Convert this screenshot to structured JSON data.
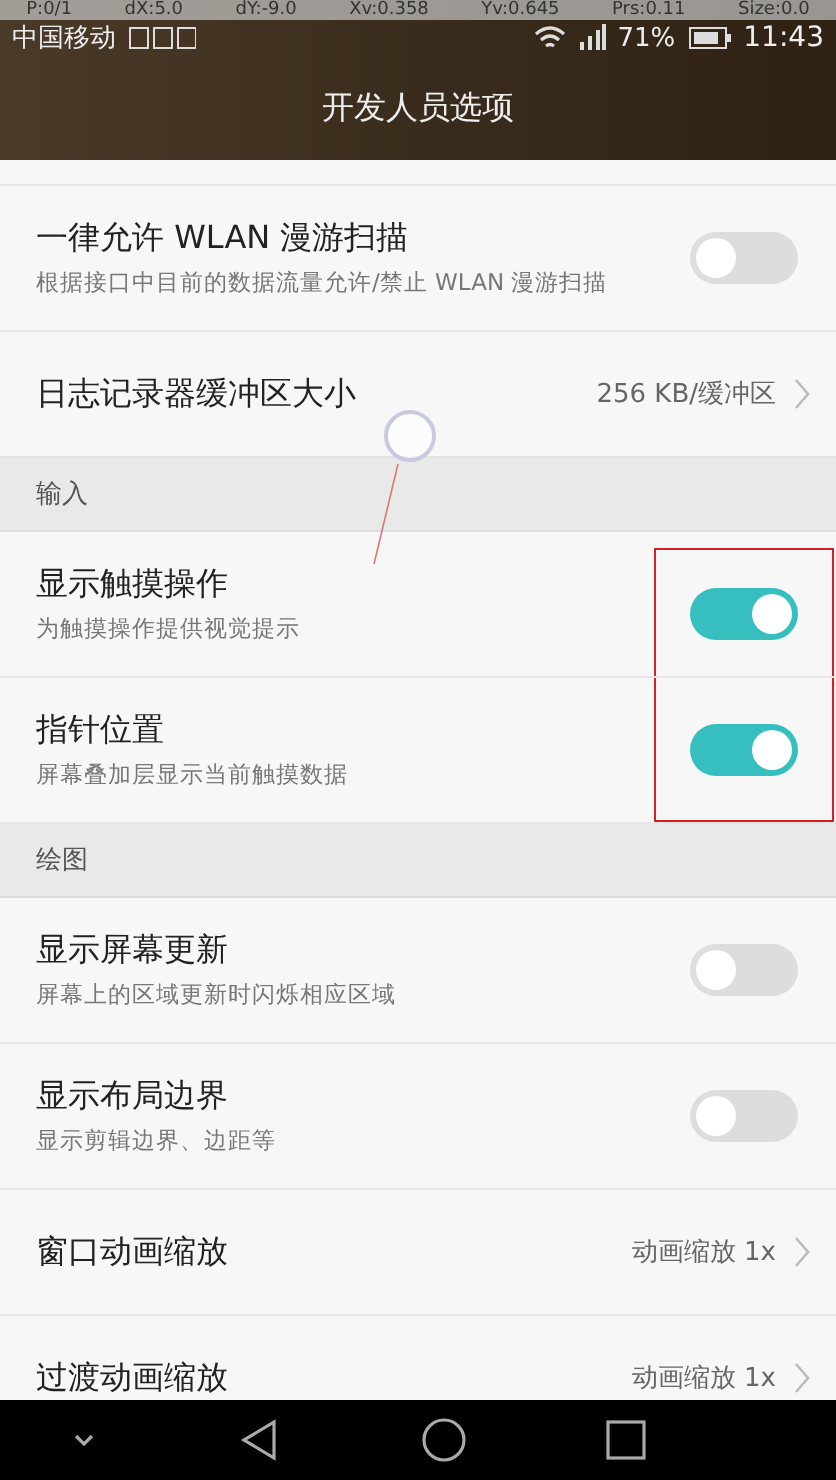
{
  "pointer_overlay": [
    "P:0/1",
    "dX:5.0",
    "dY:-9.0",
    "Xv:0.358",
    "Yv:0.645",
    "Prs:0.11",
    "Size:0.0"
  ],
  "status_bar": {
    "carrier": "中国移动",
    "battery": "71%",
    "time": "11:43"
  },
  "title": "开发人员选项",
  "items": [
    {
      "kind": "toggle",
      "title": "一律允许 WLAN 漫游扫描",
      "subtitle": "根据接口中目前的数据流量允许/禁止 WLAN 漫游扫描",
      "on": false,
      "highlighted": false
    },
    {
      "kind": "value",
      "title": "日志记录器缓冲区大小",
      "value": "256 KB/缓冲区"
    },
    {
      "kind": "header",
      "title": "输入"
    },
    {
      "kind": "toggle",
      "title": "显示触摸操作",
      "subtitle": "为触摸操作提供视觉提示",
      "on": true,
      "highlighted": true
    },
    {
      "kind": "toggle",
      "title": "指针位置",
      "subtitle": "屏幕叠加层显示当前触摸数据",
      "on": true,
      "highlighted": true
    },
    {
      "kind": "header",
      "title": "绘图"
    },
    {
      "kind": "toggle",
      "title": "显示屏幕更新",
      "subtitle": "屏幕上的区域更新时闪烁相应区域",
      "on": false,
      "highlighted": false
    },
    {
      "kind": "toggle",
      "title": "显示布局边界",
      "subtitle": "显示剪辑边界、边距等",
      "on": false,
      "highlighted": false
    },
    {
      "kind": "value",
      "title": "窗口动画缩放",
      "value": "动画缩放 1x"
    },
    {
      "kind": "value",
      "title": "过渡动画缩放",
      "value": "动画缩放 1x"
    }
  ]
}
